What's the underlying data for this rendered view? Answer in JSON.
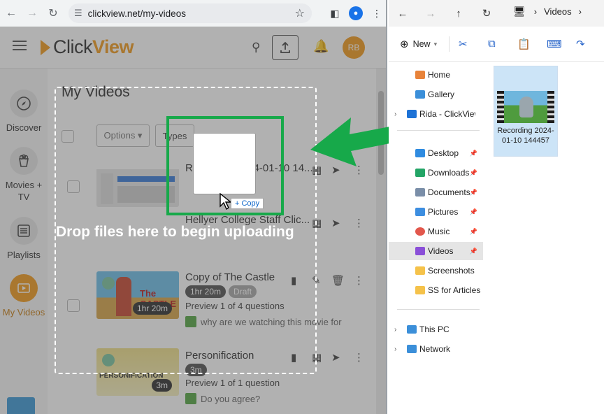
{
  "browser": {
    "url": "clickview.net/my-videos",
    "back_icon": "arrow-left",
    "forward_icon": "arrow-right",
    "reload_icon": "reload"
  },
  "app": {
    "logo_click": "Click",
    "logo_view": "View",
    "avatar_initials": "RB",
    "page_title": "My Videos",
    "options_label": "Options ▾",
    "types_label": "Types",
    "accent": "#f29b1f"
  },
  "sidebar": {
    "items": [
      {
        "label": "Discover",
        "icon": "compass-icon"
      },
      {
        "label": "Movies + TV",
        "icon": "popcorn-icon"
      },
      {
        "label": "Playlists",
        "icon": "list-icon"
      },
      {
        "label": "My Videos",
        "icon": "video-icon"
      }
    ]
  },
  "videos": [
    {
      "title": "Recording 2024-01-10 14...",
      "duration": "",
      "status": "",
      "sub": "",
      "question": ""
    },
    {
      "title": "Hellyer College Staff Clic...",
      "duration": "",
      "status": "",
      "sub": "",
      "question": ""
    },
    {
      "title": "Copy of The Castle",
      "duration": "1hr 20m",
      "status": "Draft",
      "thumb_duration": "1hr 20m",
      "sub": "Preview 1 of 4 questions",
      "question": "why are we watching this movie for"
    },
    {
      "title": "Personification",
      "duration": "3m",
      "status": "",
      "thumb_duration": "3m",
      "sub": "Preview 1 of 1 question",
      "question": "Do you agree?"
    }
  ],
  "drop": {
    "message": "Drop files here to begin uploading",
    "copy_tag": "+ Copy"
  },
  "explorer": {
    "breadcrumb": "Videos",
    "new_label": "New",
    "nav": [
      {
        "label": "Home",
        "pinned": false
      },
      {
        "label": "Gallery",
        "pinned": false
      },
      {
        "label": "Rida - ClickView",
        "pinned": false
      },
      {
        "label": "Desktop",
        "pinned": true
      },
      {
        "label": "Downloads",
        "pinned": true
      },
      {
        "label": "Documents",
        "pinned": true
      },
      {
        "label": "Pictures",
        "pinned": true
      },
      {
        "label": "Music",
        "pinned": true
      },
      {
        "label": "Videos",
        "pinned": true
      },
      {
        "label": "Screenshots",
        "pinned": false
      },
      {
        "label": "SS for Articles",
        "pinned": false
      },
      {
        "label": "This PC",
        "pinned": false
      },
      {
        "label": "Network",
        "pinned": false
      }
    ],
    "file": {
      "name": "Recording 2024-01-10 144457"
    }
  },
  "colors": {
    "highlight_green": "#17a94a",
    "selection": "#cce4f7"
  }
}
